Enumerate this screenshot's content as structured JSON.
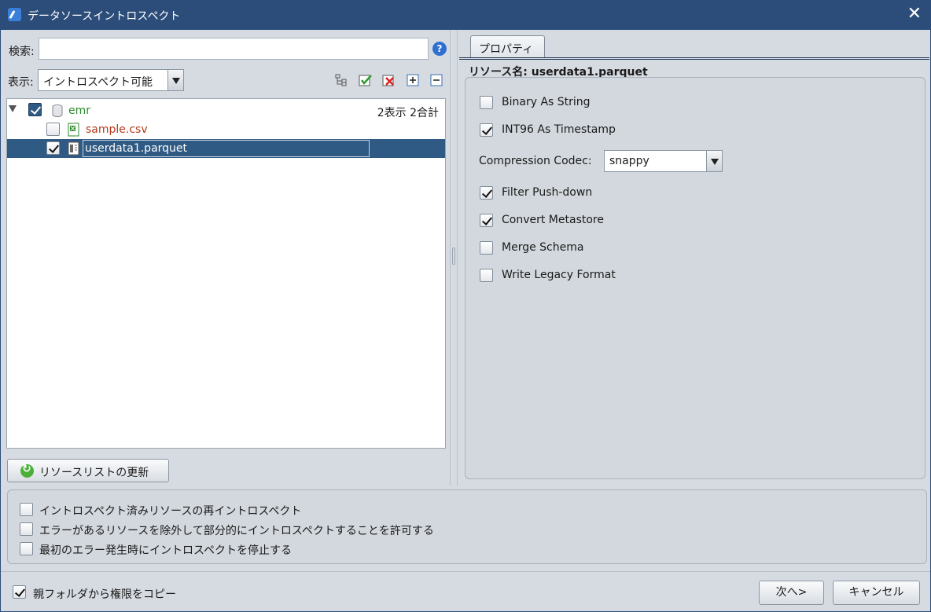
{
  "window": {
    "title": "データソースイントロスペクト"
  },
  "left": {
    "search_label": "検索:",
    "search_value": "",
    "display_label": "表示:",
    "display_value": "イントロスペクト可能",
    "toolbar_icons": [
      "expand-tree-icon",
      "check-all-icon",
      "uncheck-all-icon",
      "expand-all-icon",
      "collapse-all-icon"
    ],
    "tree": [
      {
        "label": "emr",
        "checked": true,
        "count": "2表示 2合計",
        "color": "#2e8b2e",
        "icon": "database-icon"
      },
      {
        "label": "sample.csv",
        "checked": false,
        "color": "#b23a1a",
        "icon": "csv-file-icon"
      },
      {
        "label": "userdata1.parquet",
        "checked": true,
        "selected": true,
        "color": "#ffffff",
        "icon": "parquet-file-icon"
      }
    ],
    "refresh_label": "リソースリストの更新"
  },
  "right": {
    "tab_label": "プロパティ",
    "resource_name": "リソース名: userdata1.parquet",
    "properties": [
      {
        "label": "Binary As String",
        "checked": false
      },
      {
        "label": "INT96 As Timestamp",
        "checked": true
      },
      {
        "label": "Filter Push-down",
        "checked": true
      },
      {
        "label": "Convert Metastore",
        "checked": true
      },
      {
        "label": "Merge Schema",
        "checked": false
      },
      {
        "label": "Write Legacy Format",
        "checked": false
      }
    ],
    "codec_label": "Compression Codec:",
    "codec_value": "snappy"
  },
  "options": [
    {
      "label": "イントロスペクト済みリソースの再イントロスペクト",
      "checked": false
    },
    {
      "label": "エラーがあるリソースを除外して部分的にイントロスペクトすることを許可する",
      "checked": false
    },
    {
      "label": "最初のエラー発生時にイントロスペクトを停止する",
      "checked": false
    }
  ],
  "footer": {
    "copy_permissions_label": "親フォルダから権限をコピー",
    "copy_permissions_checked": true,
    "next_label": "次へ>",
    "cancel_label": "キャンセル"
  }
}
